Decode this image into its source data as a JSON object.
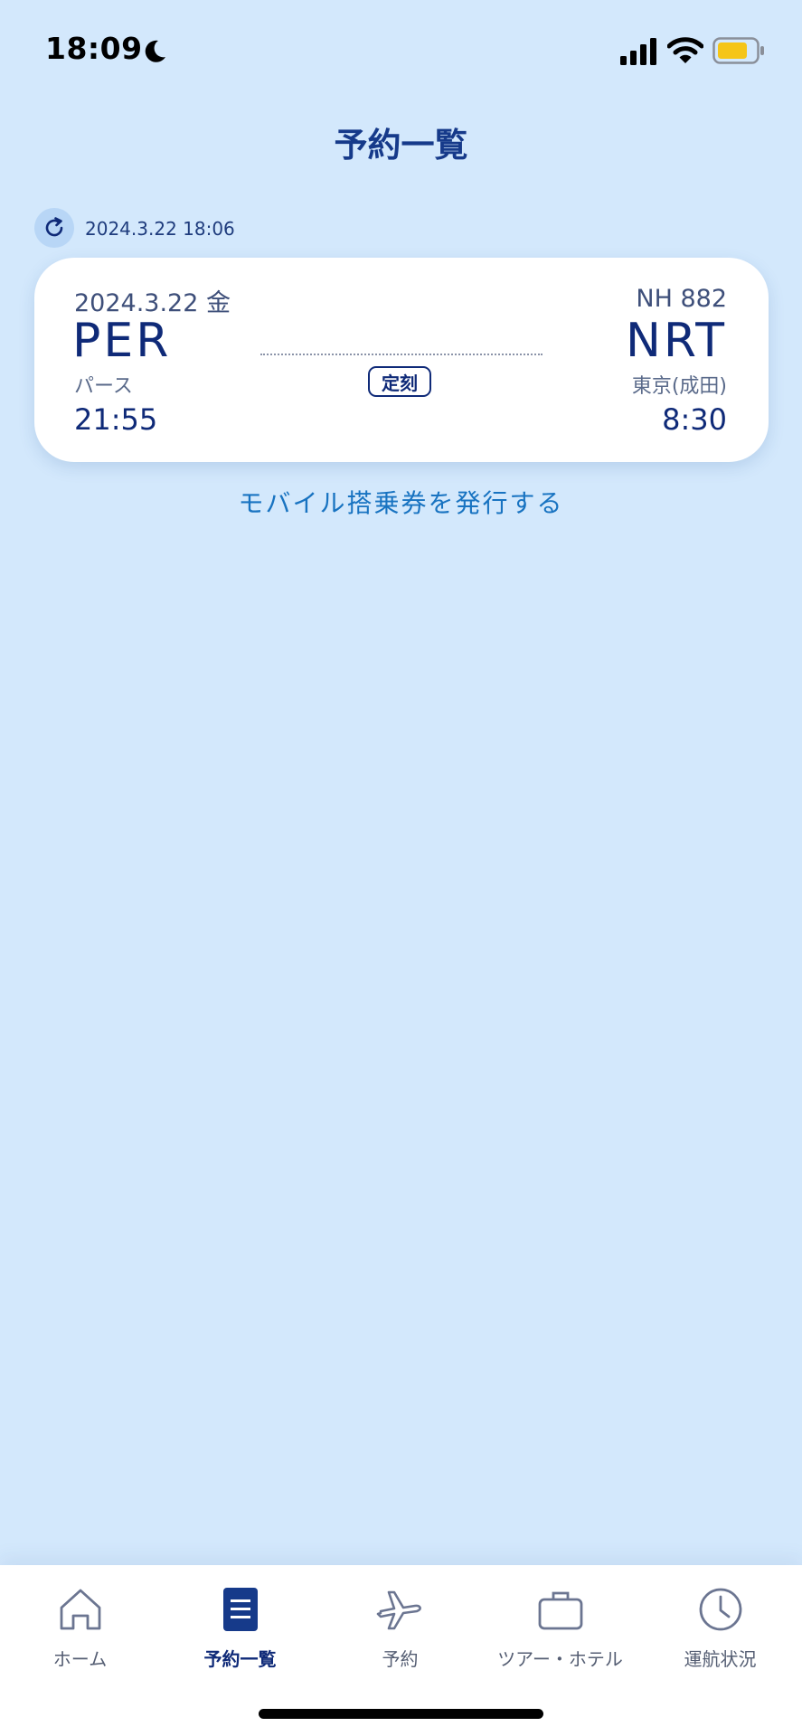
{
  "status_bar": {
    "time": "18:09"
  },
  "header": {
    "title": "予約一覧"
  },
  "refresh": {
    "last_updated": "2024.3.22 18:06"
  },
  "flight": {
    "date": "2024.3.22 金",
    "flight_number": "NH 882",
    "departure": {
      "code": "PER",
      "city": "パース",
      "time": "21:55"
    },
    "arrival": {
      "code": "NRT",
      "city": "東京(成田)",
      "time": "8:30"
    },
    "status": "定刻"
  },
  "boarding_pass_link": "モバイル搭乗券を発行する",
  "tabbar": {
    "items": [
      {
        "label": "ホーム",
        "icon": "home-icon"
      },
      {
        "label": "予約一覧",
        "icon": "list-icon",
        "active": true
      },
      {
        "label": "予約",
        "icon": "airplane-icon"
      },
      {
        "label": "ツアー・ホテル",
        "icon": "briefcase-icon"
      },
      {
        "label": "運航状況",
        "icon": "clock-icon"
      }
    ]
  },
  "colors": {
    "background": "#d3e8fc",
    "primary": "#0f2a78",
    "link": "#1873c1",
    "battery": "#f5c518"
  }
}
